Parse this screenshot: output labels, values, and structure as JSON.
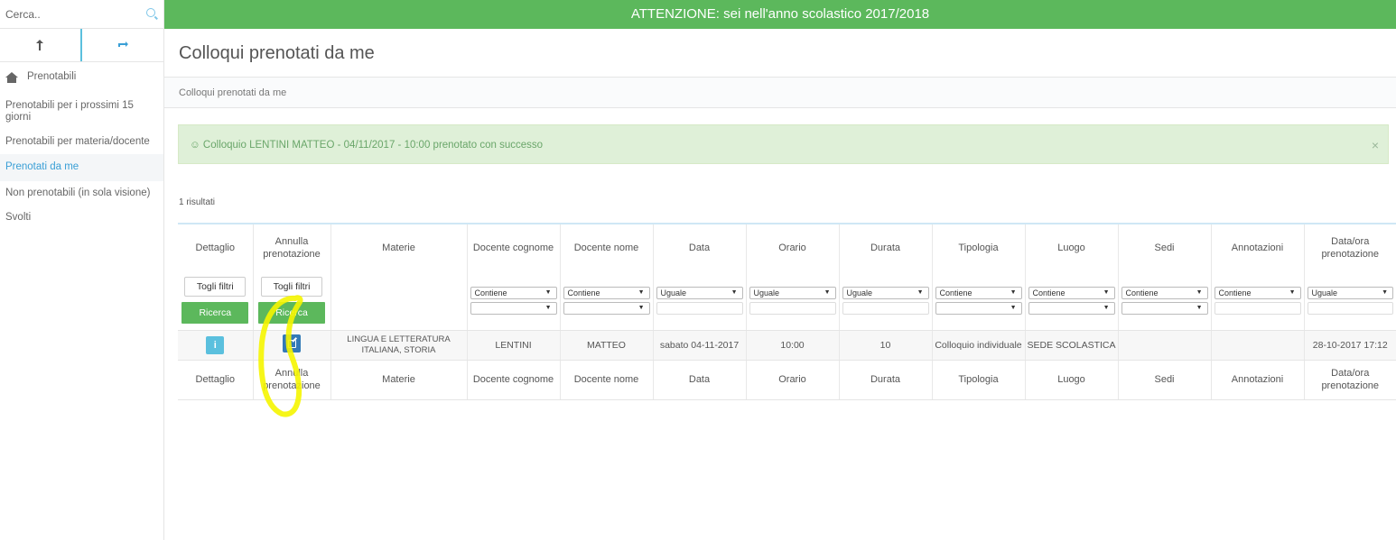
{
  "search": {
    "placeholder": "Cerca.."
  },
  "banner": {
    "text": "ATTENZIONE: sei nell'anno scolastico 2017/2018"
  },
  "sidebar": {
    "toggle_left_icon": "arrow-up-icon",
    "toggle_right_icon": "refresh-icon",
    "items": [
      {
        "label": "Prenotabili",
        "icon": "home-icon"
      },
      {
        "label": "Prenotabili per i prossimi 15 giorni"
      },
      {
        "label": "Prenotabili per materia/docente"
      },
      {
        "label": "Prenotati da me",
        "active": true
      },
      {
        "label": "Non prenotabili (in sola visione)"
      },
      {
        "label": "Svolti"
      }
    ]
  },
  "page": {
    "title": "Colloqui prenotati da me",
    "breadcrumb": "Colloqui prenotati da me",
    "alert": "☺ Colloquio LENTINI MATTEO - 04/11/2017 - 10:00 prenotato con successo",
    "alert_close": "×",
    "results": "1 risultati"
  },
  "table": {
    "columns": [
      "Dettaglio",
      "Annulla prenotazione",
      "Materie",
      "Docente cognome",
      "Docente nome",
      "Data",
      "Orario",
      "Durata",
      "Tipologia",
      "Luogo",
      "Sedi",
      "Annotazioni",
      "Data/ora prenotazione"
    ],
    "filters": {
      "togli_filtri": "Togli filtri",
      "ricerca": "Ricerca",
      "contiene": "Contiene",
      "uguale": "Uguale",
      "arrow": "▼"
    },
    "row": {
      "dettaglio": "i",
      "materie": "LINGUA E LETTERATURA ITALIANA, STORIA",
      "docente_cognome": "LENTINI",
      "docente_nome": "MATTEO",
      "data": "sabato 04-11-2017",
      "orario": "10:00",
      "durata": "10",
      "tipologia": "Colloquio individuale",
      "luogo": "SEDE SCOLASTICA",
      "sedi": "",
      "annotazioni": "",
      "data_ora": "28-10-2017 17:12"
    }
  },
  "colors": {
    "banner": "#5cb85c",
    "active_link": "#3a9fd6",
    "highlight": "#f5f500"
  }
}
